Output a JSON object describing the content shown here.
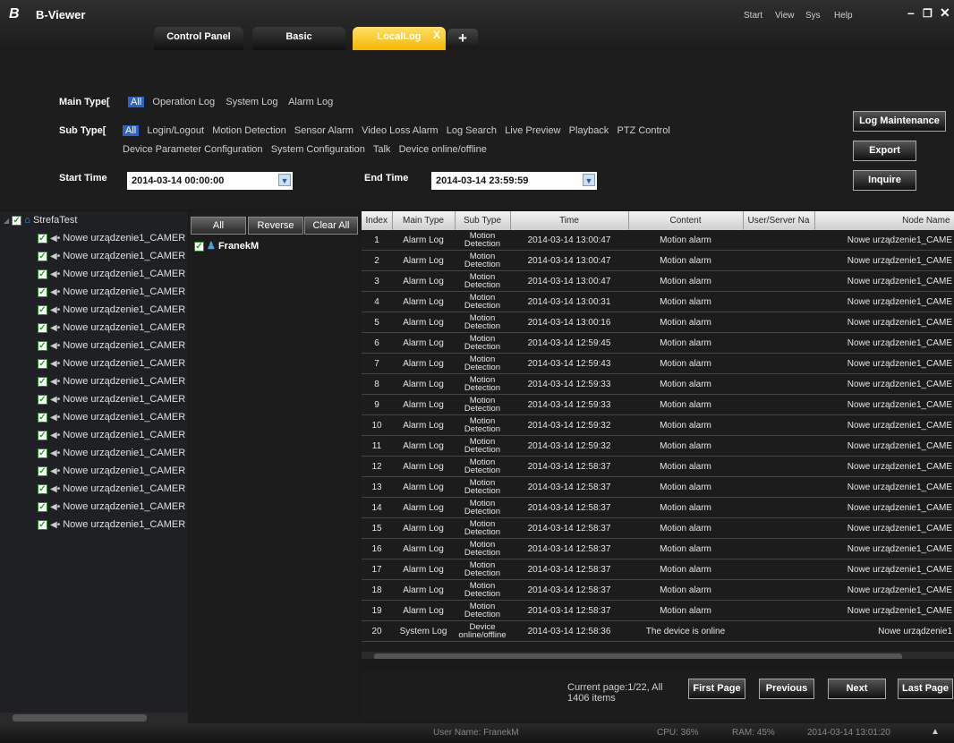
{
  "app": {
    "title": "B-Viewer",
    "logo": "B"
  },
  "tabs": [
    {
      "label": "Control Panel"
    },
    {
      "label": "Basic"
    },
    {
      "label": "LocalLog",
      "close": "X"
    }
  ],
  "tab_add": "+",
  "menu": [
    "Start",
    "View",
    "Sys",
    "Help"
  ],
  "window_controls": {
    "minimize": "–",
    "restore": "❐",
    "close": "✕"
  },
  "filter": {
    "main_type_label": "Main Type[",
    "main_types": [
      "All",
      "Operation Log",
      "System Log",
      "Alarm Log"
    ],
    "sub_type_label": "Sub Type[",
    "sub_types_row1": [
      "All",
      "Login/Logout",
      "Motion Detection",
      "Sensor Alarm",
      "Video Loss Alarm",
      "Log Search",
      "Live Preview",
      "Playback",
      "PTZ Control"
    ],
    "sub_types_row2": [
      "Device Parameter Configuration",
      "System Configuration",
      "Talk",
      "Device online/offline"
    ],
    "start_label": "Start Time",
    "start_value": "2014-03-14 00:00:00",
    "end_label": "End Time",
    "end_value": "2014-03-14 23:59:59",
    "btn_maintenance": "Log Maintenance",
    "btn_export": "Export",
    "btn_inquire": "Inquire"
  },
  "tree": {
    "root": "StrefaTest",
    "children": [
      "Nowe urządzenie1_CAMER",
      "Nowe urządzenie1_CAMER",
      "Nowe urządzenie1_CAMER",
      "Nowe urządzenie1_CAMER",
      "Nowe urządzenie1_CAMER",
      "Nowe urządzenie1_CAMER",
      "Nowe urządzenie1_CAMER",
      "Nowe urządzenie1_CAMER",
      "Nowe urządzenie1_CAMER",
      "Nowe urządzenie1_CAMER",
      "Nowe urządzenie1_CAMER",
      "Nowe urządzenie1_CAMER",
      "Nowe urządzenie1_CAMER",
      "Nowe urządzenie1_CAMER",
      "Nowe urządzenie1_CAMER",
      "Nowe urządzenie1_CAMER",
      "Nowe urządzenie1_CAMER"
    ]
  },
  "users": {
    "btn_all": "All",
    "btn_reverse": "Reverse",
    "btn_clear": "Clear All",
    "items": [
      "FranekM"
    ]
  },
  "table": {
    "headers": [
      "Index",
      "Main Type",
      "Sub Type",
      "Time",
      "Content",
      "User/Server Na",
      "Node Name"
    ],
    "rows": [
      [
        "1",
        "Alarm Log",
        "Motion Detection",
        "2014-03-14 13:00:47",
        "Motion alarm",
        "",
        "Nowe urządzenie1_CAME"
      ],
      [
        "2",
        "Alarm Log",
        "Motion Detection",
        "2014-03-14 13:00:47",
        "Motion alarm",
        "",
        "Nowe urządzenie1_CAME"
      ],
      [
        "3",
        "Alarm Log",
        "Motion Detection",
        "2014-03-14 13:00:47",
        "Motion alarm",
        "",
        "Nowe urządzenie1_CAME"
      ],
      [
        "4",
        "Alarm Log",
        "Motion Detection",
        "2014-03-14 13:00:31",
        "Motion alarm",
        "",
        "Nowe urządzenie1_CAME"
      ],
      [
        "5",
        "Alarm Log",
        "Motion Detection",
        "2014-03-14 13:00:16",
        "Motion alarm",
        "",
        "Nowe urządzenie1_CAME"
      ],
      [
        "6",
        "Alarm Log",
        "Motion Detection",
        "2014-03-14 12:59:45",
        "Motion alarm",
        "",
        "Nowe urządzenie1_CAME"
      ],
      [
        "7",
        "Alarm Log",
        "Motion Detection",
        "2014-03-14 12:59:43",
        "Motion alarm",
        "",
        "Nowe urządzenie1_CAME"
      ],
      [
        "8",
        "Alarm Log",
        "Motion Detection",
        "2014-03-14 12:59:33",
        "Motion alarm",
        "",
        "Nowe urządzenie1_CAME"
      ],
      [
        "9",
        "Alarm Log",
        "Motion Detection",
        "2014-03-14 12:59:33",
        "Motion alarm",
        "",
        "Nowe urządzenie1_CAME"
      ],
      [
        "10",
        "Alarm Log",
        "Motion Detection",
        "2014-03-14 12:59:32",
        "Motion alarm",
        "",
        "Nowe urządzenie1_CAME"
      ],
      [
        "11",
        "Alarm Log",
        "Motion Detection",
        "2014-03-14 12:59:32",
        "Motion alarm",
        "",
        "Nowe urządzenie1_CAME"
      ],
      [
        "12",
        "Alarm Log",
        "Motion Detection",
        "2014-03-14 12:58:37",
        "Motion alarm",
        "",
        "Nowe urządzenie1_CAME"
      ],
      [
        "13",
        "Alarm Log",
        "Motion Detection",
        "2014-03-14 12:58:37",
        "Motion alarm",
        "",
        "Nowe urządzenie1_CAME"
      ],
      [
        "14",
        "Alarm Log",
        "Motion Detection",
        "2014-03-14 12:58:37",
        "Motion alarm",
        "",
        "Nowe urządzenie1_CAME"
      ],
      [
        "15",
        "Alarm Log",
        "Motion Detection",
        "2014-03-14 12:58:37",
        "Motion alarm",
        "",
        "Nowe urządzenie1_CAME"
      ],
      [
        "16",
        "Alarm Log",
        "Motion Detection",
        "2014-03-14 12:58:37",
        "Motion alarm",
        "",
        "Nowe urządzenie1_CAME"
      ],
      [
        "17",
        "Alarm Log",
        "Motion Detection",
        "2014-03-14 12:58:37",
        "Motion alarm",
        "",
        "Nowe urządzenie1_CAME"
      ],
      [
        "18",
        "Alarm Log",
        "Motion Detection",
        "2014-03-14 12:58:37",
        "Motion alarm",
        "",
        "Nowe urządzenie1_CAME"
      ],
      [
        "19",
        "Alarm Log",
        "Motion Detection",
        "2014-03-14 12:58:37",
        "Motion alarm",
        "",
        "Nowe urządzenie1_CAME"
      ],
      [
        "20",
        "System Log",
        "Device online/offline",
        "2014-03-14 12:58:36",
        "The device is online",
        "",
        "Nowe urządzenie1"
      ]
    ]
  },
  "paging": {
    "info": "Current page:1/22, All 1406 items",
    "first": "First Page",
    "prev": "Previous",
    "next": "Next",
    "last": "Last Page"
  },
  "status": {
    "user": "User Name: FranekM",
    "cpu": "CPU: 36%",
    "ram": "RAM: 45%",
    "datetime": "2014-03-14 13:01:20"
  },
  "colors": {
    "accent_tab": "#f2b800",
    "selected": "#2a64c8",
    "check": "#2a9a2a"
  }
}
